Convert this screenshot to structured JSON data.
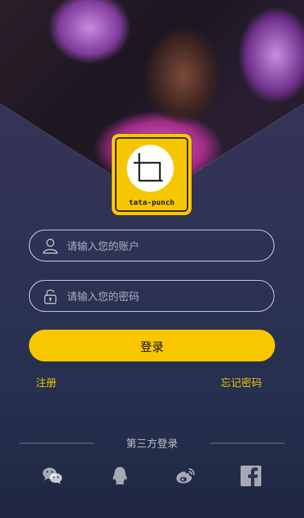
{
  "logo": {
    "text": "tata-punch"
  },
  "form": {
    "account_placeholder": "请输入您的账户",
    "password_placeholder": "请输入您的密码",
    "login_label": "登录",
    "register_label": "注册",
    "forgot_label": "忘记密码"
  },
  "third_party": {
    "title": "第三方登录",
    "providers": [
      "wechat-icon",
      "qq-icon",
      "weibo-icon",
      "facebook-icon"
    ]
  },
  "colors": {
    "accent": "#f9c700",
    "link": "#f3c500"
  }
}
